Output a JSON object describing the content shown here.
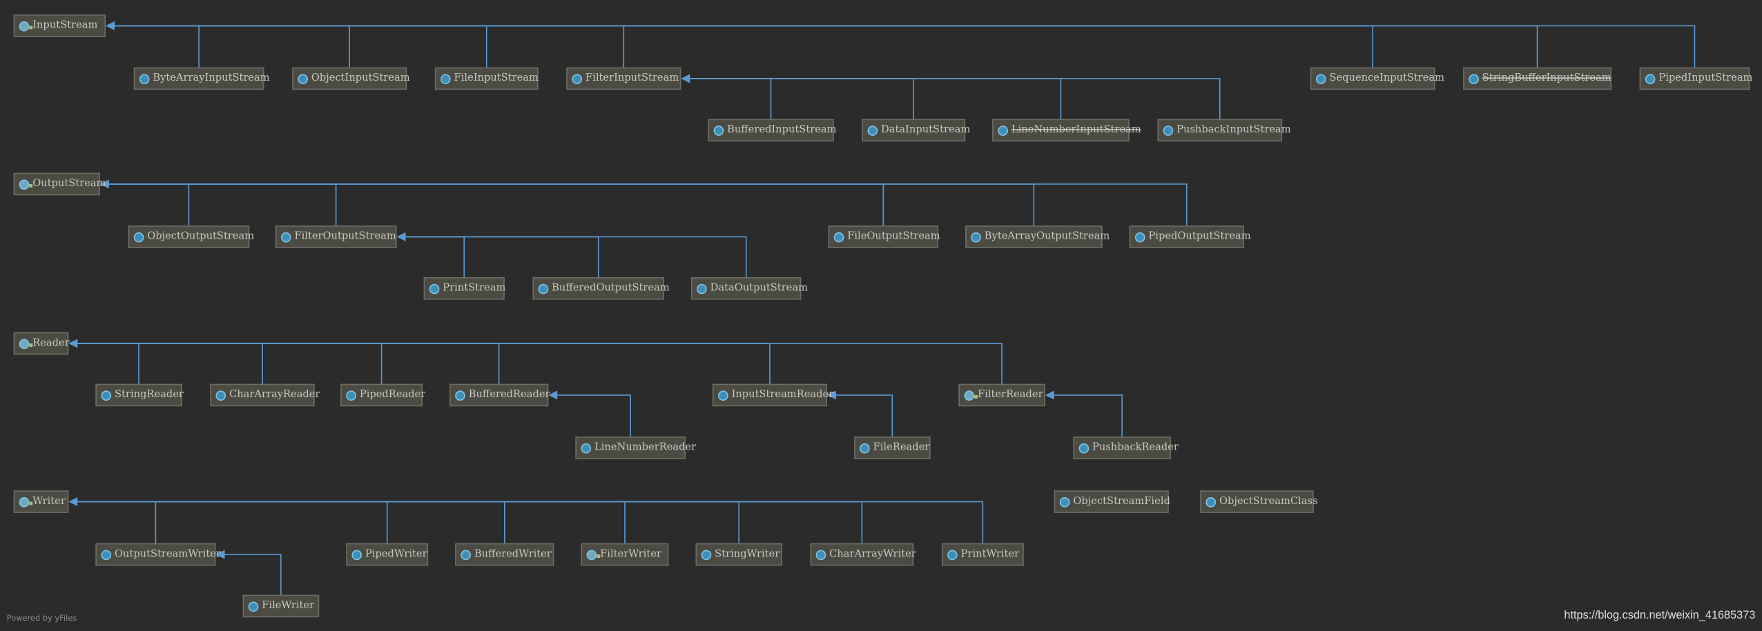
{
  "colors": {
    "background": "#2b2b2b",
    "edge": "#5b9bd5",
    "node": "#4b4a43",
    "class_icon": "#3d8fb8"
  },
  "nodes": [
    {
      "id": "inputstream",
      "label": "InputStream",
      "kind": "abstract-interface"
    },
    {
      "id": "bytearrayinputstream",
      "label": "ByteArrayInputStream"
    },
    {
      "id": "objectinputstream",
      "label": "ObjectInputStream"
    },
    {
      "id": "fileinputstream",
      "label": "FileInputStream"
    },
    {
      "id": "filterinputstream",
      "label": "FilterInputStream"
    },
    {
      "id": "sequenceinputstream",
      "label": "SequenceInputStream"
    },
    {
      "id": "stringbufferinputstream",
      "label": "StringBufferInputStream",
      "deprecated": true
    },
    {
      "id": "pipedinputstream",
      "label": "PipedInputStream"
    },
    {
      "id": "bufferedinputstream",
      "label": "BufferedInputStream"
    },
    {
      "id": "datainputstream",
      "label": "DataInputStream"
    },
    {
      "id": "linenumberinputstream",
      "label": "LineNumberInputStream",
      "deprecated": true
    },
    {
      "id": "pushbackinputstream",
      "label": "PushbackInputStream"
    },
    {
      "id": "outputstream",
      "label": "OutputStream",
      "kind": "abstract"
    },
    {
      "id": "objectoutputstream",
      "label": "ObjectOutputStream"
    },
    {
      "id": "filteroutputstream",
      "label": "FilterOutputStream"
    },
    {
      "id": "fileoutputstream",
      "label": "FileOutputStream"
    },
    {
      "id": "bytearrayoutputstream",
      "label": "ByteArrayOutputStream"
    },
    {
      "id": "pipedoutputstream",
      "label": "PipedOutputStream"
    },
    {
      "id": "printstream",
      "label": "PrintStream"
    },
    {
      "id": "bufferedoutputstream",
      "label": "BufferedOutputStream"
    },
    {
      "id": "dataoutputstream",
      "label": "DataOutputStream"
    },
    {
      "id": "reader",
      "label": "Reader",
      "kind": "abstract"
    },
    {
      "id": "stringreader",
      "label": "StringReader"
    },
    {
      "id": "chararrayreader",
      "label": "CharArrayReader"
    },
    {
      "id": "pipedreader",
      "label": "PipedReader"
    },
    {
      "id": "bufferedreader",
      "label": "BufferedReader"
    },
    {
      "id": "inputstreamreader",
      "label": "InputStreamReader"
    },
    {
      "id": "filterreader",
      "label": "FilterReader",
      "kind": "abstract"
    },
    {
      "id": "linenumberreader",
      "label": "LineNumberReader"
    },
    {
      "id": "filereader",
      "label": "FileReader"
    },
    {
      "id": "pushbackreader",
      "label": "PushbackReader"
    },
    {
      "id": "objectstreamfield",
      "label": "ObjectStreamField"
    },
    {
      "id": "objectstreamclass",
      "label": "ObjectStreamClass"
    },
    {
      "id": "writer",
      "label": "Writer",
      "kind": "abstract"
    },
    {
      "id": "outputstreamwriter",
      "label": "OutputStreamWriter"
    },
    {
      "id": "pipedwriter",
      "label": "PipedWriter"
    },
    {
      "id": "bufferedwriter",
      "label": "BufferedWriter"
    },
    {
      "id": "filterwriter",
      "label": "FilterWriter",
      "kind": "abstract"
    },
    {
      "id": "stringwriter",
      "label": "StringWriter"
    },
    {
      "id": "chararraywriter",
      "label": "CharArrayWriter"
    },
    {
      "id": "printwriter",
      "label": "PrintWriter"
    },
    {
      "id": "filewriter",
      "label": "FileWriter"
    }
  ],
  "edges": [
    {
      "from": "bytearrayinputstream",
      "to": "inputstream"
    },
    {
      "from": "objectinputstream",
      "to": "inputstream"
    },
    {
      "from": "fileinputstream",
      "to": "inputstream"
    },
    {
      "from": "filterinputstream",
      "to": "inputstream"
    },
    {
      "from": "sequenceinputstream",
      "to": "inputstream"
    },
    {
      "from": "stringbufferinputstream",
      "to": "inputstream"
    },
    {
      "from": "pipedinputstream",
      "to": "inputstream"
    },
    {
      "from": "bufferedinputstream",
      "to": "filterinputstream"
    },
    {
      "from": "datainputstream",
      "to": "filterinputstream"
    },
    {
      "from": "linenumberinputstream",
      "to": "filterinputstream"
    },
    {
      "from": "pushbackinputstream",
      "to": "filterinputstream"
    },
    {
      "from": "objectoutputstream",
      "to": "outputstream"
    },
    {
      "from": "filteroutputstream",
      "to": "outputstream"
    },
    {
      "from": "fileoutputstream",
      "to": "outputstream"
    },
    {
      "from": "bytearrayoutputstream",
      "to": "outputstream"
    },
    {
      "from": "pipedoutputstream",
      "to": "outputstream"
    },
    {
      "from": "printstream",
      "to": "filteroutputstream"
    },
    {
      "from": "bufferedoutputstream",
      "to": "filteroutputstream"
    },
    {
      "from": "dataoutputstream",
      "to": "filteroutputstream"
    },
    {
      "from": "stringreader",
      "to": "reader"
    },
    {
      "from": "chararrayreader",
      "to": "reader"
    },
    {
      "from": "pipedreader",
      "to": "reader"
    },
    {
      "from": "bufferedreader",
      "to": "reader"
    },
    {
      "from": "inputstreamreader",
      "to": "reader"
    },
    {
      "from": "filterreader",
      "to": "reader"
    },
    {
      "from": "linenumberreader",
      "to": "bufferedreader"
    },
    {
      "from": "filereader",
      "to": "inputstreamreader"
    },
    {
      "from": "pushbackreader",
      "to": "filterreader"
    },
    {
      "from": "outputstreamwriter",
      "to": "writer"
    },
    {
      "from": "pipedwriter",
      "to": "writer"
    },
    {
      "from": "bufferedwriter",
      "to": "writer"
    },
    {
      "from": "filterwriter",
      "to": "writer"
    },
    {
      "from": "stringwriter",
      "to": "writer"
    },
    {
      "from": "chararraywriter",
      "to": "writer"
    },
    {
      "from": "printwriter",
      "to": "writer"
    },
    {
      "from": "filewriter",
      "to": "outputstreamwriter"
    }
  ],
  "footer": {
    "powered_by": "Powered by yFiles",
    "url": "https://blog.csdn.net/weixin_41685373"
  }
}
